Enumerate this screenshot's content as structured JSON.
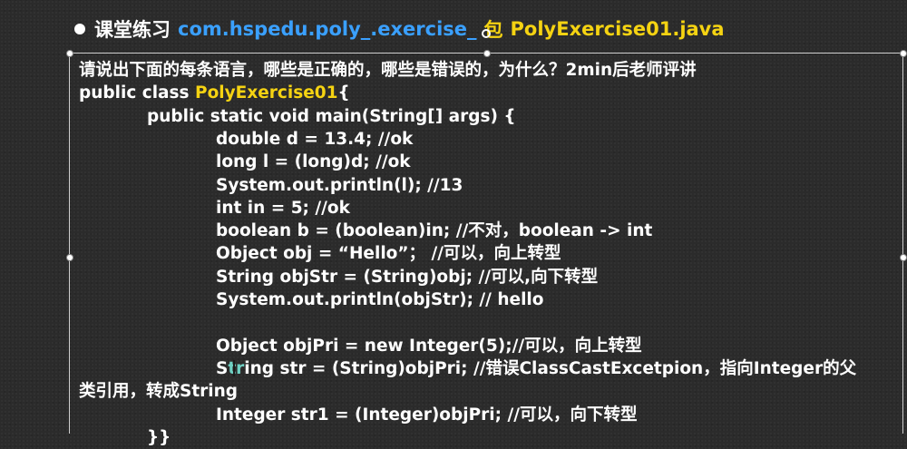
{
  "title": {
    "label": "课堂练习",
    "package": "com.hspedu.poly_.exercise_",
    "pkg_word": "包",
    "file": "PolyExercise01.java"
  },
  "question": "请说出下面的每条语言，哪些是正确的，哪些是错误的，为什么？2min后老师评讲",
  "code": {
    "class_prefix": "public class ",
    "class_name": "PolyExercise01",
    "class_suffix": "{",
    "main_decl": "public static void main(String[] args) {",
    "lines": [
      "double d = 13.4; //ok",
      "long l = (long)d; //ok",
      "System.out.println(l);   //13",
      "int in = 5; //ok",
      "boolean b = (boolean)in; //不对，boolean -> int",
      "Object obj = “Hello”； //可以，向上转型",
      "String objStr = (String)obj;  //可以,向下转型",
      "System.out.println(objStr); // hello",
      "",
      "Object objPri = new Integer(5);//可以，向上转型"
    ],
    "str_line_pre": "S",
    "str_line_cursor": "tr",
    "str_line_post": "ing str = (String)objPri; //错误ClassCastExcetpion，指向Integer的父",
    "str_line_wrap": "类引用，转成String",
    "last_line": "Integer str1 = (Integer)objPri; //可以，向下转型",
    "closing": "}}"
  }
}
